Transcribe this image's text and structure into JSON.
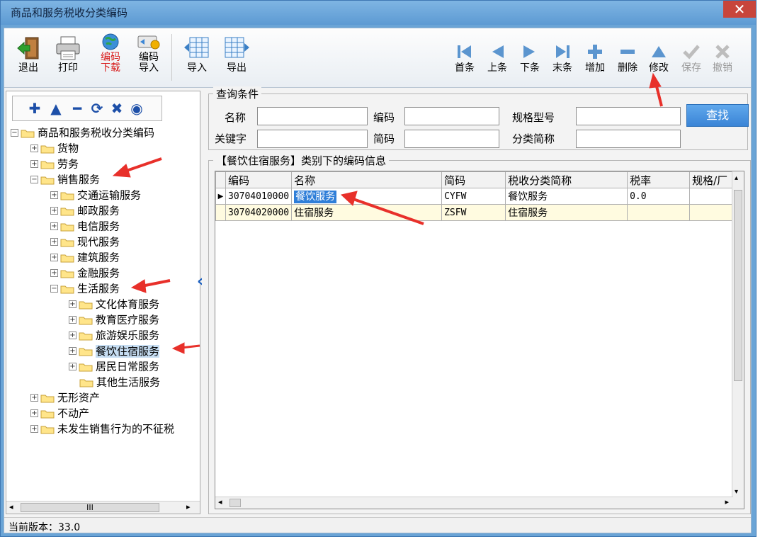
{
  "window": {
    "title": "商品和服务税收分类编码"
  },
  "toolbar": {
    "exit": "退出",
    "print": "打印",
    "download": [
      "编码",
      "下载"
    ],
    "import_code": [
      "编码",
      "导入"
    ],
    "import": "导入",
    "export": "导出",
    "first": "首条",
    "prev": "上条",
    "next": "下条",
    "last": "末条",
    "add": "增加",
    "delete": "删除",
    "modify": "修改",
    "save": "保存",
    "cancel": "撤销"
  },
  "tree": {
    "root": "商品和服务税收分类编码",
    "nodes": {
      "goods": "货物",
      "labor": "劳务",
      "sales": "销售服务",
      "transport": "交通运输服务",
      "postal": "邮政服务",
      "telecom": "电信服务",
      "modern": "现代服务",
      "construction": "建筑服务",
      "finance": "金融服务",
      "life": "生活服务",
      "culture": "文化体育服务",
      "edu": "教育医疗服务",
      "travel": "旅游娱乐服务",
      "catering": "餐饮住宿服务",
      "resident": "居民日常服务",
      "other_life": "其他生活服务",
      "intangible": "无形资产",
      "realestate": "不动产",
      "nosale": "未发生销售行为的不征税"
    },
    "scroll_mark": "III"
  },
  "query": {
    "title": "查询条件",
    "name_label": "名称",
    "code_label": "编码",
    "spec_label": "规格型号",
    "keyword_label": "关键字",
    "short_label": "简码",
    "category_label": "分类简称",
    "search_button": "查找"
  },
  "grid": {
    "title": "【餐饮住宿服务】类别下的编码信息",
    "columns": [
      "编码",
      "名称",
      "简码",
      "税收分类简称",
      "税率",
      "规格/厂"
    ],
    "rows": [
      [
        "30704010000",
        "餐饮服务",
        "CYFW",
        "餐饮服务",
        "0.0",
        ""
      ],
      [
        "30704020000",
        "住宿服务",
        "ZSFW",
        "住宿服务",
        "",
        ""
      ]
    ]
  },
  "status": {
    "version": "当前版本：33.0"
  }
}
